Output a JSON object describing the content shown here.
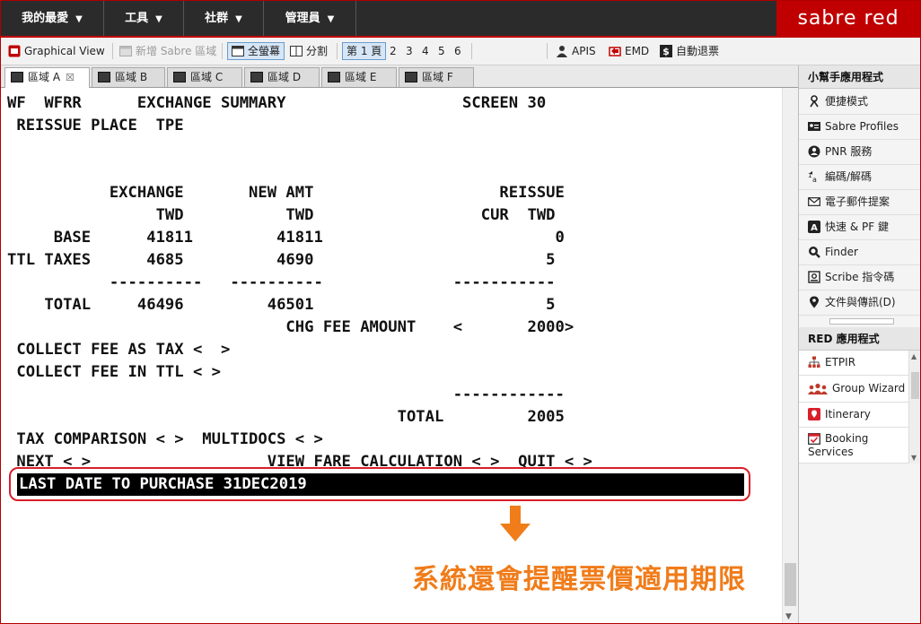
{
  "menubar": {
    "items": [
      {
        "label": "我的最愛",
        "caret": "▼"
      },
      {
        "label": "工具",
        "caret": "▼"
      },
      {
        "label": "社群",
        "caret": "▼"
      },
      {
        "label": "管理員",
        "caret": "▼"
      }
    ],
    "brand": "sabre red"
  },
  "toolbar": {
    "graphical_view": "Graphical View",
    "new_area": "新增 Sabre 區域",
    "fullscreen": "全螢幕",
    "split": "分割",
    "pages": [
      "第 1 頁",
      "2",
      "3",
      "4",
      "5",
      "6"
    ],
    "apis": "APIS",
    "emd": "EMD",
    "auto_refund": "自動退票"
  },
  "tabs": [
    {
      "label": "區域 A",
      "close": "☒"
    },
    {
      "label": "區域 B"
    },
    {
      "label": "區域 C"
    },
    {
      "label": "區域 D"
    },
    {
      "label": "區域 E"
    },
    {
      "label": "區域 F"
    }
  ],
  "terminal": {
    "lines": [
      "WF  WFRR      EXCHANGE SUMMARY                   SCREEN 30",
      " REISSUE PLACE  TPE",
      "",
      "",
      "           EXCHANGE       NEW AMT                    REISSUE",
      "                TWD           TWD                  CUR  TWD",
      "     BASE      41811         41811                         0",
      "TTL TAXES      4685          4690                         5",
      "           ----------   ----------              -----------",
      "    TOTAL     46496         46501                         5",
      "                              CHG FEE AMOUNT    <       2000>",
      " COLLECT FEE AS TAX <  >",
      " COLLECT FEE IN TTL < >",
      "                                                ------------",
      "                                          TOTAL         2005",
      " TAX COMPARISON < >  MULTIDOCS < >",
      " NEXT < >                   VIEW FARE CALCULATION < >  QUIT < >"
    ],
    "highlight_line": "LAST DATE TO PURCHASE 31DEC2019"
  },
  "annotation": "系統還會提醒票價適用期限",
  "panel": {
    "section1_title": "小幫手應用程式",
    "section1_items": [
      {
        "label": "便捷模式",
        "icon": "person-icon"
      },
      {
        "label": "Sabre Profiles",
        "icon": "profile-card-icon"
      },
      {
        "label": "PNR 服務",
        "icon": "user-circle-icon"
      },
      {
        "label": "編碼/解碼",
        "icon": "encode-icon"
      },
      {
        "label": "電子郵件提案",
        "icon": "mail-icon"
      },
      {
        "label": "快速 & PF 鍵",
        "icon": "key-a-icon"
      },
      {
        "label": "Finder",
        "icon": "search-icon"
      },
      {
        "label": "Scribe 指令碼",
        "icon": "script-icon"
      },
      {
        "label": "文件與傳訊(D)",
        "icon": "pin-icon"
      }
    ],
    "section2_title": "RED 應用程式",
    "section2_items": [
      {
        "label": "ETPIR",
        "icon": "org-chart-icon"
      },
      {
        "label": "Group Wizard",
        "icon": "group-icon"
      },
      {
        "label": "Itinerary",
        "icon": "itinerary-icon"
      },
      {
        "label": "Booking Services",
        "icon": "calendar-check-icon"
      }
    ]
  },
  "colors": {
    "brand_red": "#c00000",
    "annotation_orange": "#f07c1a",
    "outline_red": "#d81f2a"
  }
}
